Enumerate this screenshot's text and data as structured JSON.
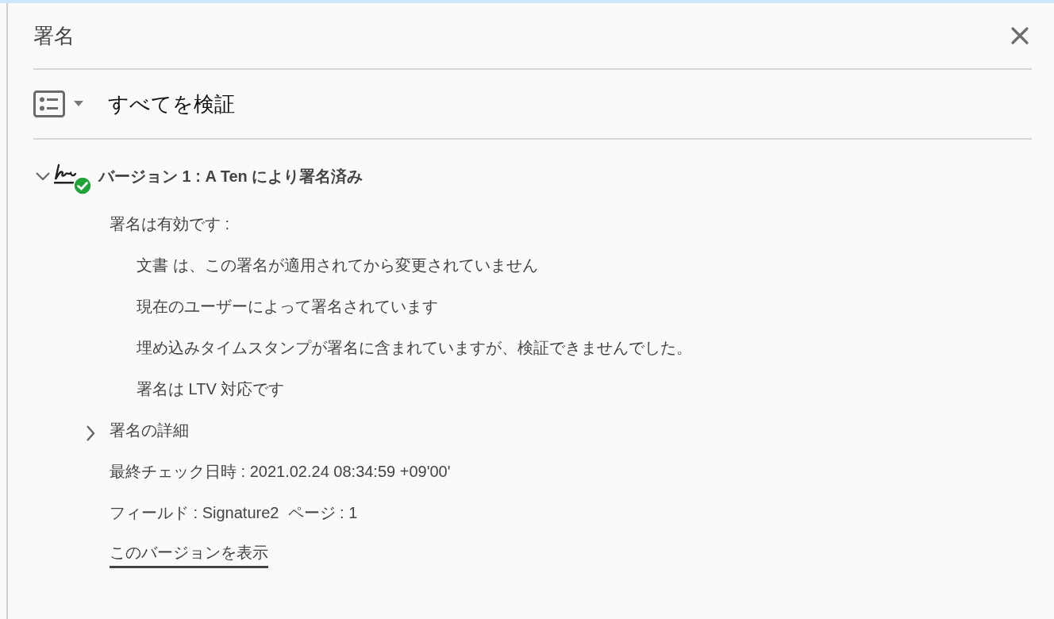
{
  "panel": {
    "title": "署名"
  },
  "toolbar": {
    "label": "すべてを検証"
  },
  "versions": [
    {
      "label": "バージョン 1 : A Ten により署名済み",
      "expanded": true,
      "valid": true,
      "summary": "署名は有効です :",
      "checks": [
        "文書 は、この署名が適用されてから変更されていません",
        "現在のユーザーによって署名されています",
        "埋め込みタイムスタンプが署名に含まれていますが、検証できませんでした。",
        "署名は LTV 対応です"
      ],
      "details": {
        "label": "署名の詳細",
        "expanded": false
      },
      "last_checked": "最終チェック日時 : 2021.02.24 08:34:59 +09'00'",
      "field": "フィールド : Signature2  ページ : 1",
      "view_link": "このバージョンを表示"
    }
  ]
}
